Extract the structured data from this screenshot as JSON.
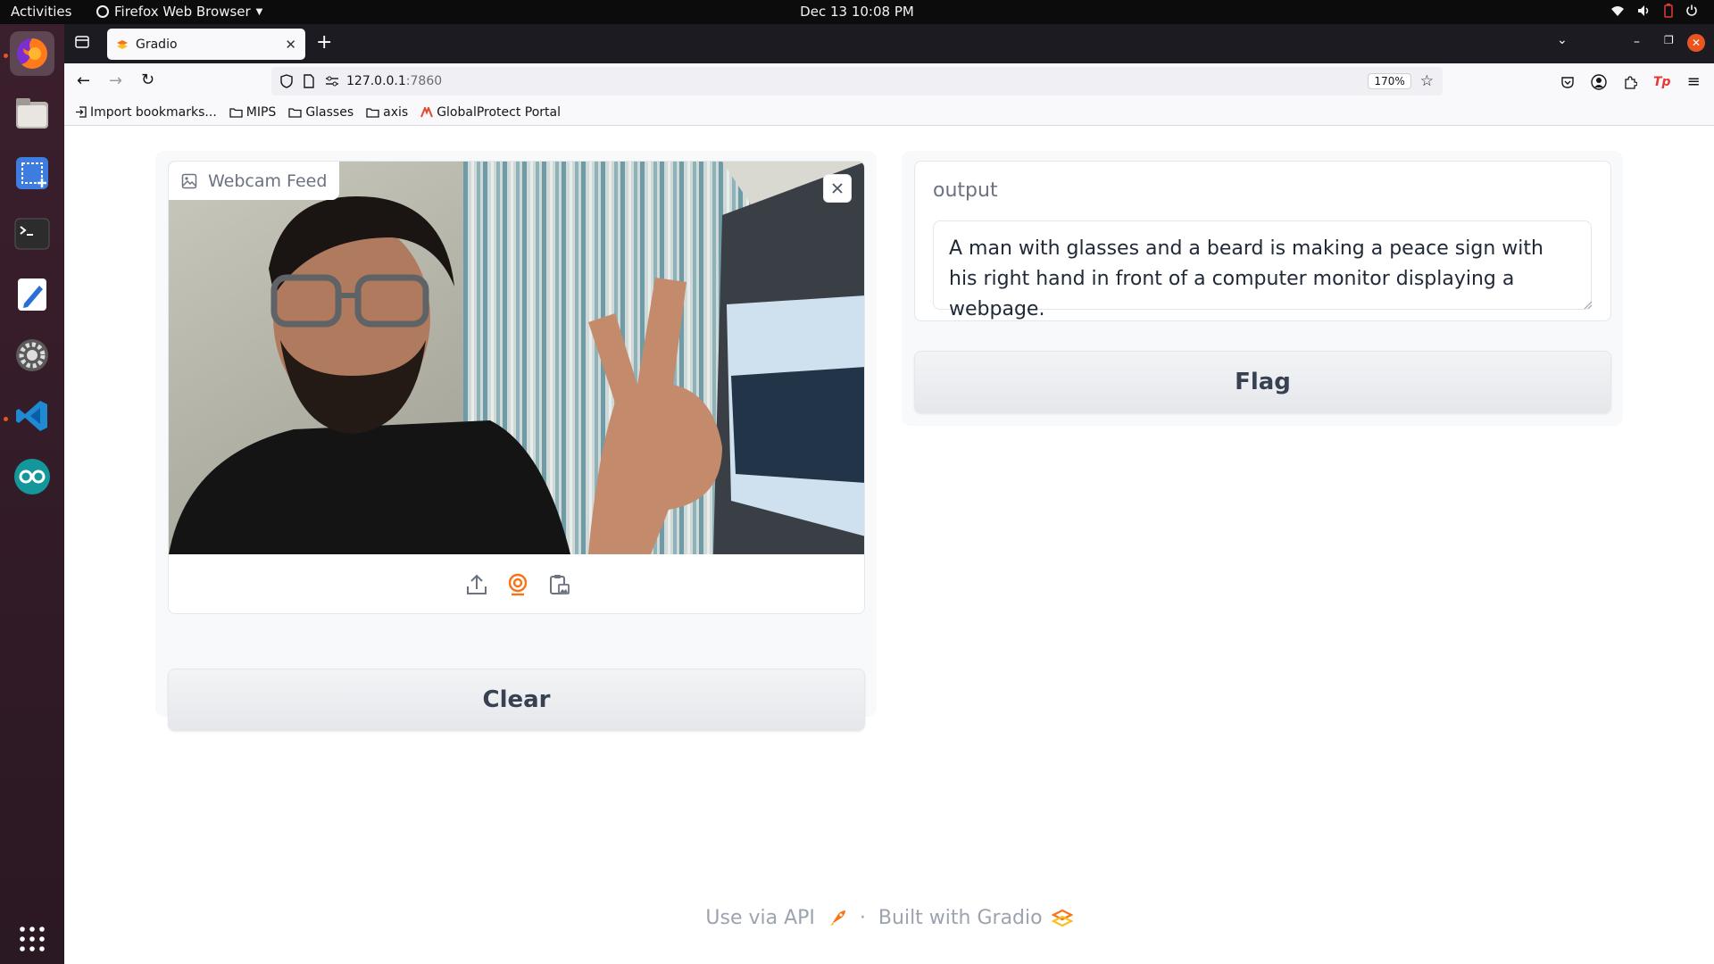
{
  "topbar": {
    "activities": "Activities",
    "app_name": "Firefox Web Browser",
    "clock": "Dec 13  10:08 PM"
  },
  "browser": {
    "tab_title": "Gradio",
    "url_host": "127.0.0.1",
    "url_port": ":7860",
    "zoom": "170%",
    "bookmarks": [
      {
        "label": "Import bookmarks..."
      },
      {
        "label": "MIPS"
      },
      {
        "label": "Glasses"
      },
      {
        "label": "axis"
      },
      {
        "label": "GlobalProtect Portal"
      }
    ]
  },
  "app": {
    "input_label": "Webcam Feed",
    "output_label": "output",
    "output_text": "A man with glasses and a beard is making a peace sign with his right hand in front of a computer monitor displaying a webpage.",
    "clear_label": "Clear",
    "flag_label": "Flag"
  },
  "footer": {
    "api_label": "Use via API",
    "separator": "·",
    "built_label": "Built with Gradio"
  },
  "colors": {
    "accent": "#f97316",
    "ubuntu_orange": "#e95420",
    "text_muted": "#9ca3af",
    "button_text": "#374151"
  }
}
